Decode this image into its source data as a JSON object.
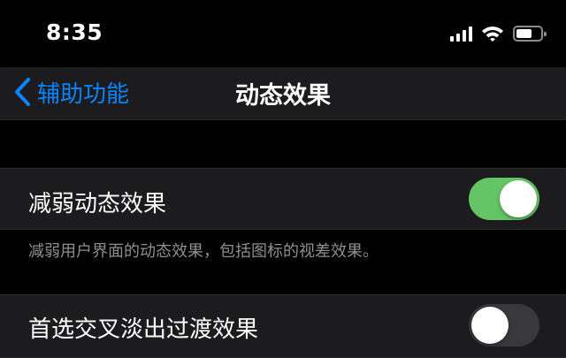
{
  "status_bar": {
    "time": "8:35",
    "battery_level_percent": 65,
    "icons": [
      "cellular-signal-icon",
      "wifi-icon",
      "battery-icon"
    ]
  },
  "nav": {
    "back_label": "辅助功能",
    "title": "动态效果",
    "accent_color": "#0a84ff"
  },
  "settings": {
    "reduce_motion": {
      "label": "减弱动态效果",
      "enabled": true,
      "footer": "减弱用户界面的动态效果，包括图标的视差效果。"
    },
    "prefer_cross_fade": {
      "label": "首选交叉淡出过渡效果",
      "enabled": false
    }
  },
  "colors": {
    "toggle_on": "#64c466",
    "toggle_off": "#39393d",
    "row_background": "#1c1c1e",
    "page_background": "#000000"
  }
}
